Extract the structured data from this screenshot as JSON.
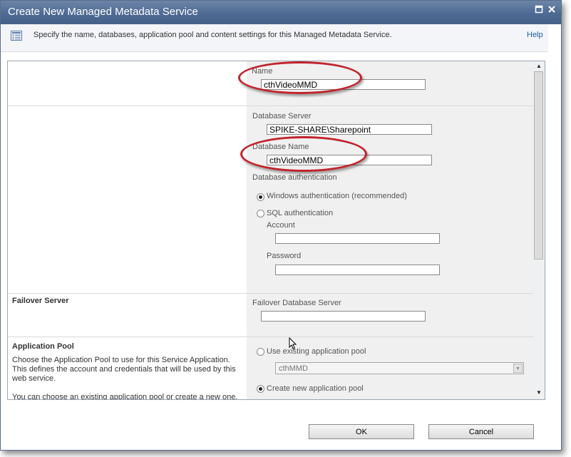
{
  "window": {
    "title": "Create New Managed Metadata Service",
    "description": "Specify the name, databases, application pool and content settings for this Managed Metadata Service.",
    "help_label": "Help"
  },
  "name_section": {
    "label": "Name",
    "value": "cthVideoMMD"
  },
  "database_section": {
    "server_label": "Database Server",
    "server_value": "SPIKE-SHARE\\Sharepoint",
    "name_label": "Database Name",
    "name_value": "cthVideoMMD",
    "auth_label": "Database authentication",
    "windows_auth_label": "Windows authentication (recommended)",
    "sql_auth_label": "SQL authentication",
    "account_label": "Account",
    "account_value": "",
    "password_label": "Password",
    "password_value": "",
    "selected_auth": "windows"
  },
  "failover_section": {
    "title": "Failover Server",
    "label": "Failover Database Server",
    "value": ""
  },
  "app_pool_section": {
    "title": "Application Pool",
    "description_1": "Choose the Application Pool to use for this Service Application. This defines the account and credentials that will be used by this web service.",
    "description_2": "You can choose an existing application pool or create a new one.",
    "use_existing_label": "Use existing application pool",
    "existing_pool_value": "cthMMD",
    "create_new_label": "Create new application pool",
    "selected_option": "create_new"
  },
  "footer": {
    "ok_label": "OK",
    "cancel_label": "Cancel"
  },
  "colors": {
    "titlebar": "#4e6a94",
    "annotation": "#c0232b",
    "help_link": "#1a5ea6"
  },
  "icons": {
    "header_icon": "document-list-icon",
    "maximize": "maximize-icon",
    "close": "close-icon"
  }
}
